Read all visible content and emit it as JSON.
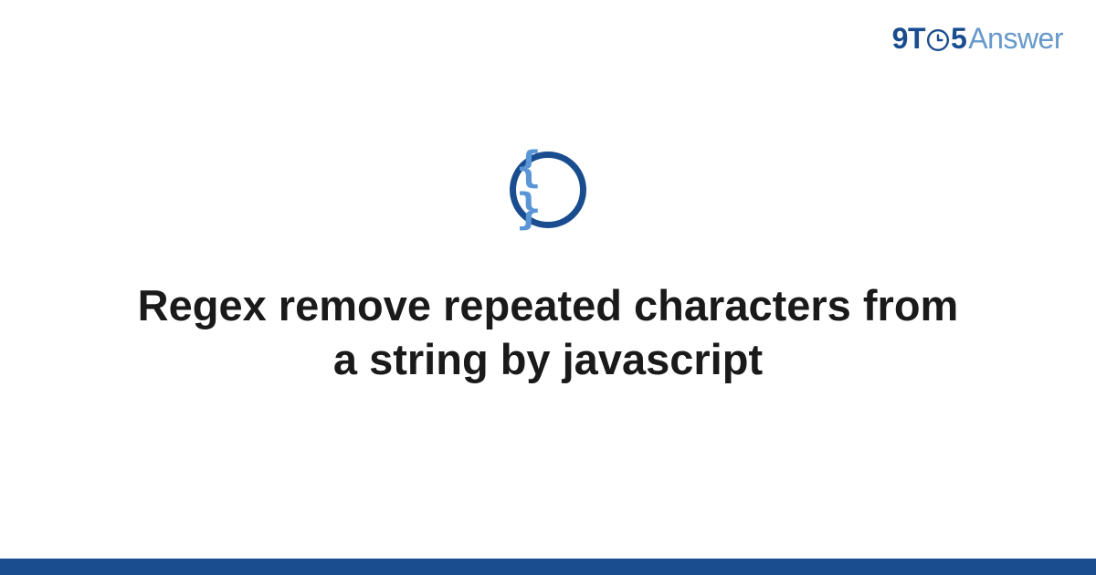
{
  "logo": {
    "part1": "9T",
    "part2": "5",
    "part3": "Answer"
  },
  "icon": {
    "name": "code-braces-icon",
    "content": "{ }"
  },
  "title": "Regex remove repeated characters from a string by javascript",
  "colors": {
    "primary": "#1a4d8f",
    "accent": "#5a96d6",
    "logo_light": "#6699cc"
  }
}
